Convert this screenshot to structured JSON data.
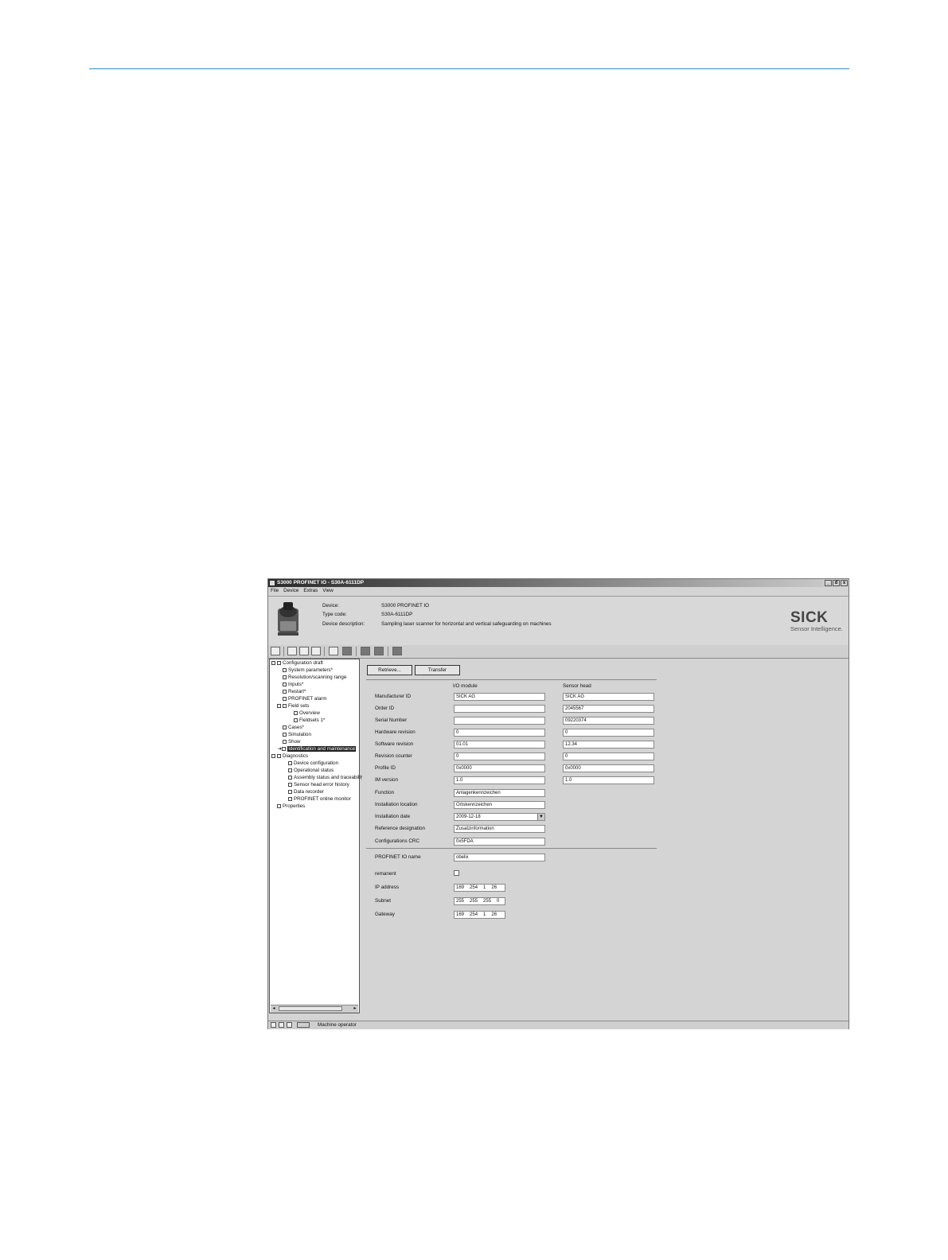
{
  "window": {
    "title": "S3000 PROFINET IO - S30A-6111DP",
    "controls": [
      "_",
      "d",
      "x"
    ]
  },
  "menu": [
    "File",
    "Device",
    "Extras",
    "View"
  ],
  "device_info": {
    "device_label": "Device:",
    "device_value": "S3000 PROFINET IO",
    "type_label": "Type code:",
    "type_value": "S30A-6111DP",
    "desc_label": "Device description:",
    "desc_value": "Sampling laser scanner for horizontal and vertical safeguarding on machines"
  },
  "brand": {
    "logo": "SICK",
    "tagline": "Sensor Intelligence."
  },
  "tree": [
    "Configuration draft",
    "System parameters*",
    "Resolution/scanning range",
    "Inputs*",
    "Restart*",
    "PROFINET alarm",
    "Field sets",
    "Overview",
    "Fieldsets 1*",
    "Cases*",
    "Simulation",
    "Show",
    "Identification and maintenance",
    "Diagnostics",
    "Device configuration",
    "Operational status",
    "Assembly status and traceability",
    "Sensor head error history",
    "Data recorder",
    "PROFINET online monitor",
    "Properties"
  ],
  "buttons": {
    "retrieve": "Retrieve...",
    "transfer": "Transfer"
  },
  "columns": {
    "io_module": "I/O module",
    "sensor_head": "Sensor head"
  },
  "identification": [
    {
      "label": "Manufacturer ID",
      "io": "SICK AG",
      "sensor": "SICK AG"
    },
    {
      "label": "Order ID",
      "io": "",
      "sensor": "2045567"
    },
    {
      "label": "Serial Number",
      "io": "",
      "sensor": "09220374"
    },
    {
      "label": "Hardware revision",
      "io": "0",
      "sensor": "0"
    },
    {
      "label": "Software revision",
      "io": "01.01",
      "sensor": "12.34"
    },
    {
      "label": "Revision counter",
      "io": "0",
      "sensor": "0"
    },
    {
      "label": "Profile ID",
      "io": "0x0000",
      "sensor": "0x0000"
    },
    {
      "label": "IM version",
      "io": "1.0",
      "sensor": "1.0"
    },
    {
      "label": "Function",
      "io": "Anlagenkennzeichen",
      "sensor": ""
    },
    {
      "label": "Installation location",
      "io": "Ortskennzeichen",
      "sensor": ""
    },
    {
      "label": "Installation date",
      "io": "2009-12-18",
      "sensor": ""
    },
    {
      "label": "Reference designation",
      "io": "Zusatzinformation",
      "sensor": ""
    },
    {
      "label": "Configurations CRC",
      "io": "0x5FDA",
      "sensor": ""
    }
  ],
  "network": {
    "name_label": "PROFINET IO name",
    "name_value": "obelix",
    "remanent_label": "remanent",
    "ip_label": "IP address",
    "ip": [
      "169",
      "254",
      "1",
      "26"
    ],
    "subnet_label": "Subnet",
    "subnet": [
      "255",
      "255",
      "255",
      "0"
    ],
    "gateway_label": "Gateway",
    "gateway": [
      "169",
      "254",
      "1",
      "26"
    ]
  },
  "status": {
    "user": "Machine operator"
  },
  "colors": {
    "rule": "#2f8fc6",
    "window_bg": "#d4d4d4"
  }
}
